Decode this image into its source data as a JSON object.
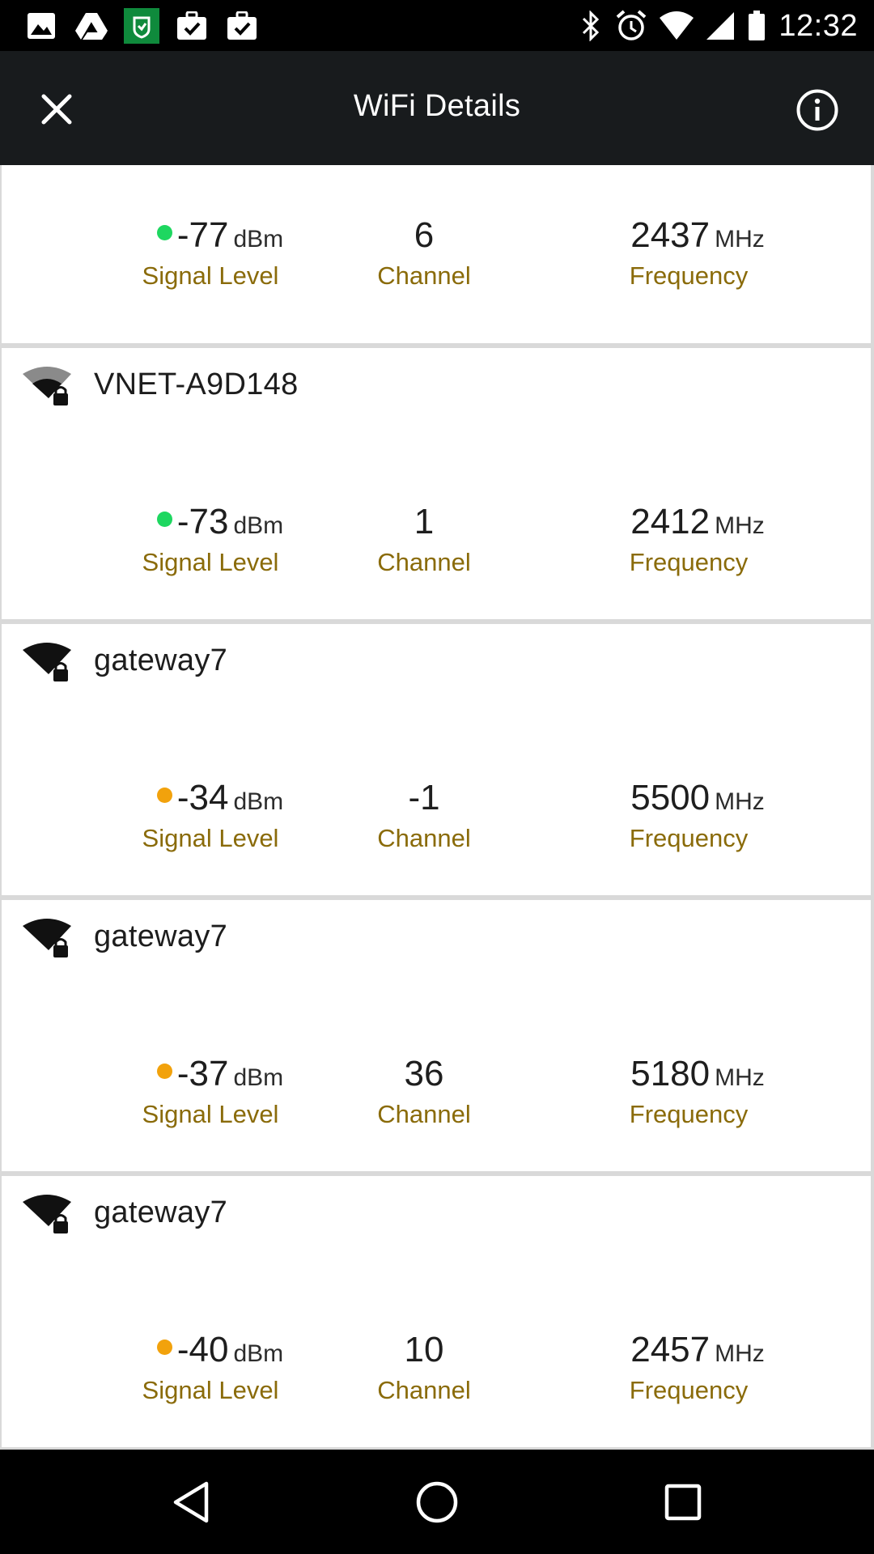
{
  "status_bar": {
    "time": "12:32",
    "left_icons": [
      "gallery-icon",
      "drive-icon",
      "shield-app-icon",
      "briefcase-check-icon",
      "briefcase-check-icon"
    ],
    "right_icons": [
      "bluetooth-icon",
      "alarm-icon",
      "wifi-icon",
      "cell-signal-icon",
      "battery-icon"
    ]
  },
  "app_bar": {
    "title": "WiFi Details",
    "close_icon": "close-icon",
    "info_icon": "info-icon"
  },
  "labels": {
    "signal": "Signal Level",
    "channel": "Channel",
    "frequency": "Frequency",
    "dbm": "dBm",
    "mhz": "MHz"
  },
  "colors": {
    "dot_green": "#1ed760",
    "dot_orange": "#f2a20c",
    "label_gold": "#8a6b0a",
    "app_bar": "#181b1d"
  },
  "networks": [
    {
      "ssid": "",
      "signal": "-77",
      "channel": "6",
      "frequency": "2437",
      "dot": "green",
      "wifi_strength": "partial"
    },
    {
      "ssid": "VNET-A9D148",
      "signal": "-73",
      "channel": "1",
      "frequency": "2412",
      "dot": "green",
      "wifi_strength": "partial"
    },
    {
      "ssid": "gateway7",
      "signal": "-34",
      "channel": "-1",
      "frequency": "5500",
      "dot": "orange",
      "wifi_strength": "full"
    },
    {
      "ssid": "gateway7",
      "signal": "-37",
      "channel": "36",
      "frequency": "5180",
      "dot": "orange",
      "wifi_strength": "full"
    },
    {
      "ssid": "gateway7",
      "signal": "-40",
      "channel": "10",
      "frequency": "2457",
      "dot": "orange",
      "wifi_strength": "full"
    }
  ]
}
